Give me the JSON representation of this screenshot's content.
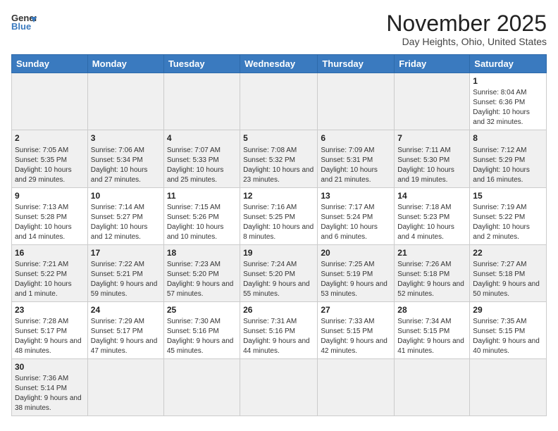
{
  "logo": {
    "text_general": "General",
    "text_blue": "Blue"
  },
  "header": {
    "month_year": "November 2025",
    "location": "Day Heights, Ohio, United States"
  },
  "weekdays": [
    "Sunday",
    "Monday",
    "Tuesday",
    "Wednesday",
    "Thursday",
    "Friday",
    "Saturday"
  ],
  "weeks": [
    [
      {
        "day": "",
        "info": ""
      },
      {
        "day": "",
        "info": ""
      },
      {
        "day": "",
        "info": ""
      },
      {
        "day": "",
        "info": ""
      },
      {
        "day": "",
        "info": ""
      },
      {
        "day": "",
        "info": ""
      },
      {
        "day": "1",
        "info": "Sunrise: 8:04 AM\nSunset: 6:36 PM\nDaylight: 10 hours\nand 32 minutes."
      }
    ],
    [
      {
        "day": "2",
        "info": "Sunrise: 7:05 AM\nSunset: 5:35 PM\nDaylight: 10 hours\nand 29 minutes."
      },
      {
        "day": "3",
        "info": "Sunrise: 7:06 AM\nSunset: 5:34 PM\nDaylight: 10 hours\nand 27 minutes."
      },
      {
        "day": "4",
        "info": "Sunrise: 7:07 AM\nSunset: 5:33 PM\nDaylight: 10 hours\nand 25 minutes."
      },
      {
        "day": "5",
        "info": "Sunrise: 7:08 AM\nSunset: 5:32 PM\nDaylight: 10 hours\nand 23 minutes."
      },
      {
        "day": "6",
        "info": "Sunrise: 7:09 AM\nSunset: 5:31 PM\nDaylight: 10 hours\nand 21 minutes."
      },
      {
        "day": "7",
        "info": "Sunrise: 7:11 AM\nSunset: 5:30 PM\nDaylight: 10 hours\nand 19 minutes."
      },
      {
        "day": "8",
        "info": "Sunrise: 7:12 AM\nSunset: 5:29 PM\nDaylight: 10 hours\nand 16 minutes."
      }
    ],
    [
      {
        "day": "9",
        "info": "Sunrise: 7:13 AM\nSunset: 5:28 PM\nDaylight: 10 hours\nand 14 minutes."
      },
      {
        "day": "10",
        "info": "Sunrise: 7:14 AM\nSunset: 5:27 PM\nDaylight: 10 hours\nand 12 minutes."
      },
      {
        "day": "11",
        "info": "Sunrise: 7:15 AM\nSunset: 5:26 PM\nDaylight: 10 hours\nand 10 minutes."
      },
      {
        "day": "12",
        "info": "Sunrise: 7:16 AM\nSunset: 5:25 PM\nDaylight: 10 hours\nand 8 minutes."
      },
      {
        "day": "13",
        "info": "Sunrise: 7:17 AM\nSunset: 5:24 PM\nDaylight: 10 hours\nand 6 minutes."
      },
      {
        "day": "14",
        "info": "Sunrise: 7:18 AM\nSunset: 5:23 PM\nDaylight: 10 hours\nand 4 minutes."
      },
      {
        "day": "15",
        "info": "Sunrise: 7:19 AM\nSunset: 5:22 PM\nDaylight: 10 hours\nand 2 minutes."
      }
    ],
    [
      {
        "day": "16",
        "info": "Sunrise: 7:21 AM\nSunset: 5:22 PM\nDaylight: 10 hours\nand 1 minute."
      },
      {
        "day": "17",
        "info": "Sunrise: 7:22 AM\nSunset: 5:21 PM\nDaylight: 9 hours\nand 59 minutes."
      },
      {
        "day": "18",
        "info": "Sunrise: 7:23 AM\nSunset: 5:20 PM\nDaylight: 9 hours\nand 57 minutes."
      },
      {
        "day": "19",
        "info": "Sunrise: 7:24 AM\nSunset: 5:20 PM\nDaylight: 9 hours\nand 55 minutes."
      },
      {
        "day": "20",
        "info": "Sunrise: 7:25 AM\nSunset: 5:19 PM\nDaylight: 9 hours\nand 53 minutes."
      },
      {
        "day": "21",
        "info": "Sunrise: 7:26 AM\nSunset: 5:18 PM\nDaylight: 9 hours\nand 52 minutes."
      },
      {
        "day": "22",
        "info": "Sunrise: 7:27 AM\nSunset: 5:18 PM\nDaylight: 9 hours\nand 50 minutes."
      }
    ],
    [
      {
        "day": "23",
        "info": "Sunrise: 7:28 AM\nSunset: 5:17 PM\nDaylight: 9 hours\nand 48 minutes."
      },
      {
        "day": "24",
        "info": "Sunrise: 7:29 AM\nSunset: 5:17 PM\nDaylight: 9 hours\nand 47 minutes."
      },
      {
        "day": "25",
        "info": "Sunrise: 7:30 AM\nSunset: 5:16 PM\nDaylight: 9 hours\nand 45 minutes."
      },
      {
        "day": "26",
        "info": "Sunrise: 7:31 AM\nSunset: 5:16 PM\nDaylight: 9 hours\nand 44 minutes."
      },
      {
        "day": "27",
        "info": "Sunrise: 7:33 AM\nSunset: 5:15 PM\nDaylight: 9 hours\nand 42 minutes."
      },
      {
        "day": "28",
        "info": "Sunrise: 7:34 AM\nSunset: 5:15 PM\nDaylight: 9 hours\nand 41 minutes."
      },
      {
        "day": "29",
        "info": "Sunrise: 7:35 AM\nSunset: 5:15 PM\nDaylight: 9 hours\nand 40 minutes."
      }
    ],
    [
      {
        "day": "30",
        "info": "Sunrise: 7:36 AM\nSunset: 5:14 PM\nDaylight: 9 hours\nand 38 minutes."
      },
      {
        "day": "",
        "info": ""
      },
      {
        "day": "",
        "info": ""
      },
      {
        "day": "",
        "info": ""
      },
      {
        "day": "",
        "info": ""
      },
      {
        "day": "",
        "info": ""
      },
      {
        "day": "",
        "info": ""
      }
    ]
  ]
}
